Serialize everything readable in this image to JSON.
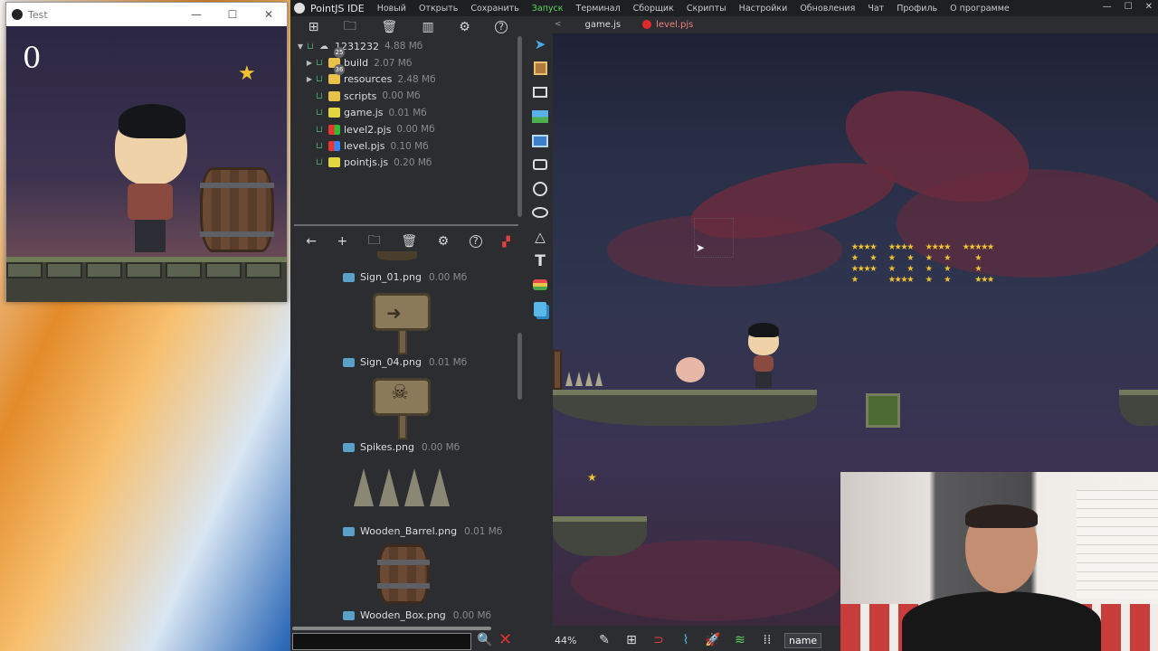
{
  "test_window": {
    "title": "Test",
    "score": "0",
    "controls": [
      "—",
      "☐",
      "✕"
    ]
  },
  "ide": {
    "app_name": "PointJS IDE",
    "menu": [
      "Новый",
      "Открыть",
      "Сохранить",
      "Запуск",
      "Терминал",
      "Сборщик",
      "Скрипты",
      "Настройки",
      "Обновления",
      "Чат",
      "Профиль",
      "О программе"
    ],
    "active_menu": "Запуск",
    "window_controls": [
      "—",
      "☐",
      "✕"
    ],
    "tabs": [
      {
        "label": "game.js",
        "modified": false
      },
      {
        "label": "level.pjs",
        "modified": true
      }
    ],
    "file_tree": {
      "root": {
        "name": "1231232",
        "size": "4.88 Мб"
      },
      "items": [
        {
          "name": "build",
          "size": "2.07 Мб",
          "type": "folder",
          "expandable": true,
          "badge": "25"
        },
        {
          "name": "resources",
          "size": "2.48 Мб",
          "type": "folder",
          "expandable": true,
          "badge": "36"
        },
        {
          "name": "scripts",
          "size": "0.00 Мб",
          "type": "folder",
          "expandable": false
        },
        {
          "name": "game.js",
          "size": "0.01 Мб",
          "type": "js"
        },
        {
          "name": "level2.pjs",
          "size": "0.00 Мб",
          "type": "pjs"
        },
        {
          "name": "level.pjs",
          "size": "0.10 Мб",
          "type": "pjs"
        },
        {
          "name": "pointjs.js",
          "size": "0.20 Мб",
          "type": "js"
        }
      ]
    },
    "resources": [
      {
        "name": "Sign_01.png",
        "size": "0.00 Мб"
      },
      {
        "name": "Sign_04.png",
        "size": "0.01 Мб"
      },
      {
        "name": "Spikes.png",
        "size": "0.00 Мб"
      },
      {
        "name": "Wooden_Barrel.png",
        "size": "0.01 Мб"
      },
      {
        "name": "Wooden_Box.png",
        "size": "0.00 Мб"
      }
    ],
    "search": {
      "value": "",
      "placeholder": ""
    },
    "status": {
      "zoom": "44%",
      "name_field": "name"
    },
    "colors": {
      "accent_green": "#5fd35f",
      "modified_red": "#e02a2a",
      "star": "#f2c230"
    }
  }
}
